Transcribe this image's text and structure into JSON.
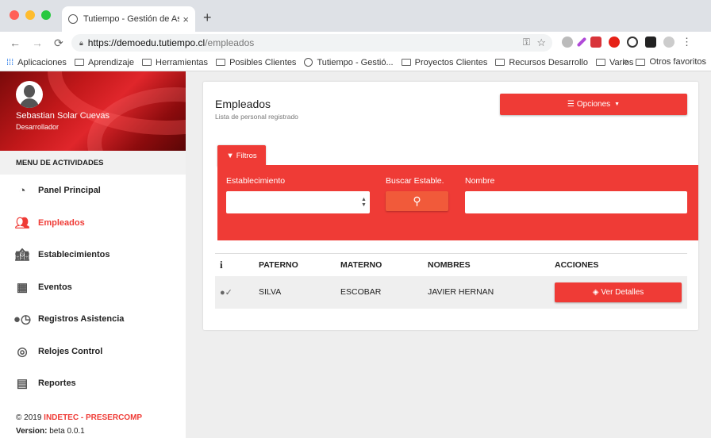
{
  "browser": {
    "tab_title": "Tutiempo - Gestión de Asistenc",
    "tab_close": "×",
    "new_tab": "+",
    "url_host": "https://demoedu.tutiempo.cl",
    "url_path": "/empleados",
    "bookmarks": [
      "Aplicaciones",
      "Aprendizaje",
      "Herramientas",
      "Posibles Clientes",
      "Tutiempo - Gestió...",
      "Proyectos Clientes",
      "Recursos Desarrollo",
      "Varios"
    ],
    "more": "»",
    "other_bookmarks": "Otros favoritos"
  },
  "sidebar": {
    "user_name": "Sebastian Solar Cuevas",
    "user_role": "Desarrollador",
    "menu_header": "MENU DE ACTIVIDADES",
    "items": [
      {
        "label": "Panel Principal",
        "icon": "dashboard-icon"
      },
      {
        "label": "Empleados",
        "icon": "users-icon",
        "active": true
      },
      {
        "label": "Establecimientos",
        "icon": "building-icon"
      },
      {
        "label": "Eventos",
        "icon": "calendar-icon"
      },
      {
        "label": "Registros Asistencia",
        "icon": "user-clock-icon"
      },
      {
        "label": "Relojes Control",
        "icon": "fingerprint-icon"
      },
      {
        "label": "Reportes",
        "icon": "report-icon"
      }
    ],
    "footer_copy": "© 2019 ",
    "footer_brand": "INDETEC - PRESERCOMP",
    "version_label": "Version:",
    "version_value": " beta 0.0.1"
  },
  "main": {
    "title": "Empleados",
    "subtitle": "Lista de personal registrado",
    "options_button": "Opciones",
    "filters_tab": "Filtros",
    "filters": {
      "establecimiento_label": "Establecimiento",
      "buscar_label": "Buscar Estable.",
      "nombre_label": "Nombre",
      "establecimiento_value": "",
      "nombre_value": ""
    },
    "table": {
      "headers": [
        "i",
        "PATERNO",
        "MATERNO",
        "NOMBRES",
        "ACCIONES"
      ],
      "rows": [
        {
          "paterno": "SILVA",
          "materno": "ESCOBAR",
          "nombres": "JAVIER HERNAN",
          "action": "Ver Detalles"
        }
      ]
    }
  },
  "colors": {
    "accent": "#ef3b36",
    "page_bg": "#eeeeee"
  }
}
